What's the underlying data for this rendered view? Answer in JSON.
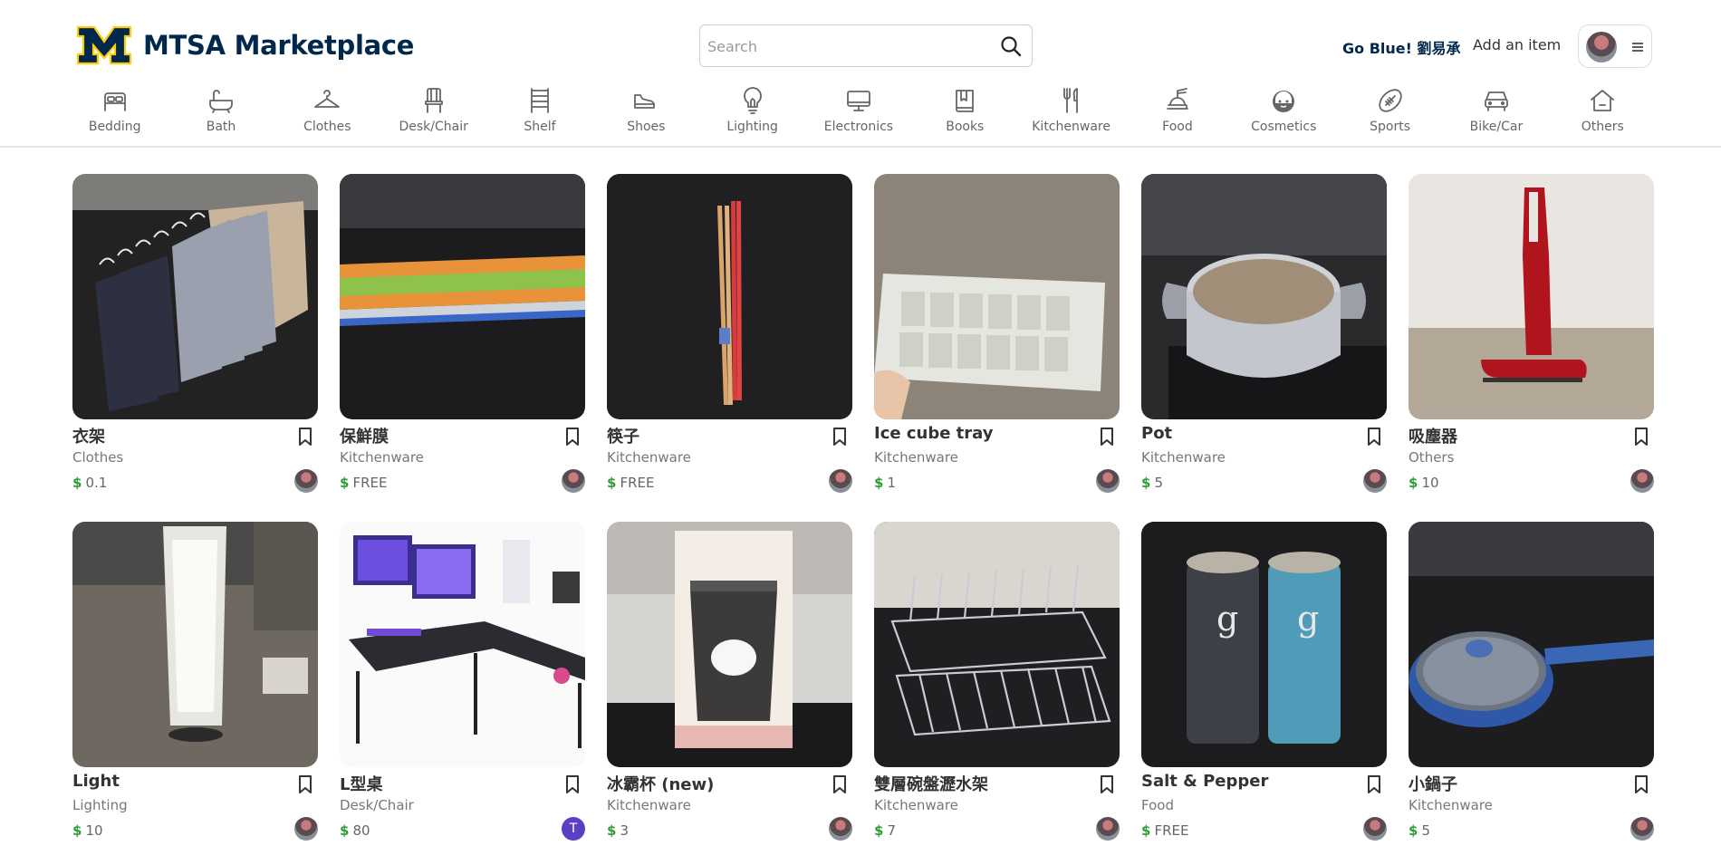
{
  "header": {
    "brand_name": "MTSA Marketplace",
    "search_placeholder": "Search",
    "greeting": "Go Blue!  劉易承",
    "add_item": "Add an item",
    "brand_color": "#00274c",
    "accent_color": "#ffcb05"
  },
  "categories": [
    {
      "label": "Bedding",
      "icon": "bed-icon"
    },
    {
      "label": "Bath",
      "icon": "bathtub-icon"
    },
    {
      "label": "Clothes",
      "icon": "hanger-icon"
    },
    {
      "label": "Desk/Chair",
      "icon": "chair-icon"
    },
    {
      "label": "Shelf",
      "icon": "shelf-icon"
    },
    {
      "label": "Shoes",
      "icon": "shoe-icon"
    },
    {
      "label": "Lighting",
      "icon": "lightbulb-icon"
    },
    {
      "label": "Electronics",
      "icon": "monitor-icon"
    },
    {
      "label": "Books",
      "icon": "book-icon"
    },
    {
      "label": "Kitchenware",
      "icon": "utensils-icon"
    },
    {
      "label": "Food",
      "icon": "food-icon"
    },
    {
      "label": "Cosmetics",
      "icon": "cosmetics-icon"
    },
    {
      "label": "Sports",
      "icon": "football-icon"
    },
    {
      "label": "Bike/Car",
      "icon": "car-icon"
    },
    {
      "label": "Others",
      "icon": "house-icon"
    }
  ],
  "listings": [
    {
      "title": "衣架",
      "category": "Clothes",
      "price": "0.1"
    },
    {
      "title": "保鮮膜",
      "category": "Kitchenware",
      "price": "FREE"
    },
    {
      "title": "筷子",
      "category": "Kitchenware",
      "price": "FREE"
    },
    {
      "title": "Ice cube tray",
      "category": "Kitchenware",
      "price": "1"
    },
    {
      "title": "Pot",
      "category": "Kitchenware",
      "price": "5"
    },
    {
      "title": "吸塵器",
      "category": "Others",
      "price": "10"
    },
    {
      "title": "Light",
      "category": "Lighting",
      "price": "10"
    },
    {
      "title": "L型桌",
      "category": "Desk/Chair",
      "price": "80",
      "seller_initial": "T"
    },
    {
      "title": "冰霸杯 (new)",
      "category": "Kitchenware",
      "price": "3"
    },
    {
      "title": "雙層碗盤瀝水架",
      "category": "Kitchenware",
      "price": "7"
    },
    {
      "title": "Salt & Pepper",
      "category": "Food",
      "price": "FREE"
    },
    {
      "title": "小鍋子",
      "category": "Kitchenware",
      "price": "5"
    }
  ],
  "price_symbol": "$"
}
